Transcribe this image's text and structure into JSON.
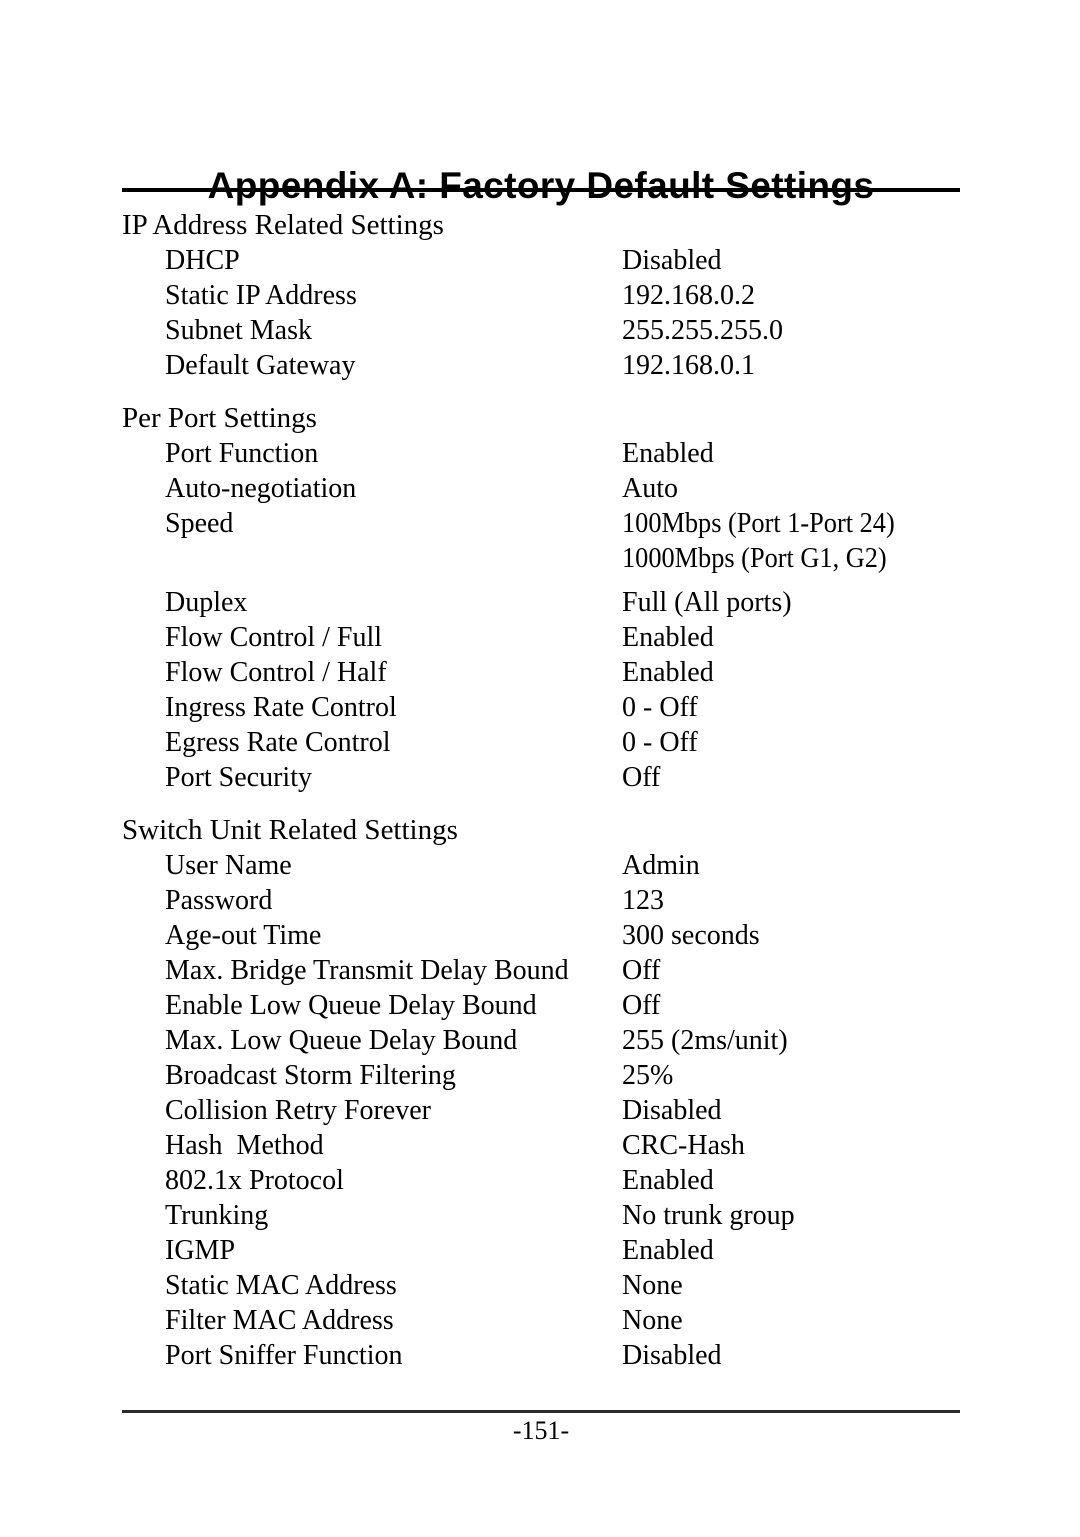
{
  "document": {
    "title": "Appendix A: Factory Default Settings",
    "page_number": "-151-"
  },
  "sections": [
    {
      "heading": "IP Address Related Settings",
      "rows": [
        {
          "label": "DHCP",
          "value": "Disabled"
        },
        {
          "label": "Static IP Address",
          "value": "192.168.0.2"
        },
        {
          "label": "Subnet Mask",
          "value": "255.255.255.0"
        },
        {
          "label": "Default Gateway",
          "value": "192.168.0.1"
        }
      ]
    },
    {
      "heading": "Per Port Settings",
      "rows": [
        {
          "label": "Port Function",
          "value": "Enabled"
        },
        {
          "label": "Auto-negotiation",
          "value": "Auto"
        },
        {
          "label": "Speed",
          "value": "100Mbps (Port 1-Port 24)"
        },
        {
          "label": "",
          "value": "1000Mbps (Port G1, G2)"
        },
        {
          "label": "Duplex",
          "value": "Full (All ports)"
        },
        {
          "label": "Flow Control / Full",
          "value": "Enabled"
        },
        {
          "label": "Flow Control / Half",
          "value": "Enabled"
        },
        {
          "label": "Ingress Rate Control",
          "value": "0 - Off"
        },
        {
          "label": "Egress Rate Control",
          "value": "0 - Off"
        },
        {
          "label": "Port Security",
          "value": "Off"
        }
      ]
    },
    {
      "heading": "Switch Unit Related Settings",
      "rows": [
        {
          "label": "User Name",
          "value": "Admin"
        },
        {
          "label": "Password",
          "value": "123"
        },
        {
          "label": "Age-out Time",
          "value": "300 seconds"
        },
        {
          "label": "Max. Bridge Transmit Delay Bound",
          "value": "Off"
        },
        {
          "label": "Enable Low Queue Delay Bound",
          "value": "Off"
        },
        {
          "label": "Max. Low Queue Delay Bound",
          "value": "255 (2ms/unit)"
        },
        {
          "label": "Broadcast Storm Filtering",
          "value": "25%"
        },
        {
          "label": "Collision Retry Forever",
          "value": "Disabled"
        },
        {
          "label": "Hash  Method",
          "value": "CRC-Hash"
        },
        {
          "label": "802.1x Protocol",
          "value": "Enabled"
        },
        {
          "label": "Trunking",
          "value": "No trunk group"
        },
        {
          "label": "IGMP",
          "value": "Enabled"
        },
        {
          "label": "Static MAC Address",
          "value": "None"
        },
        {
          "label": "Filter MAC Address",
          "value": "None"
        },
        {
          "label": "Port Sniffer Function",
          "value": "Disabled"
        }
      ]
    }
  ]
}
